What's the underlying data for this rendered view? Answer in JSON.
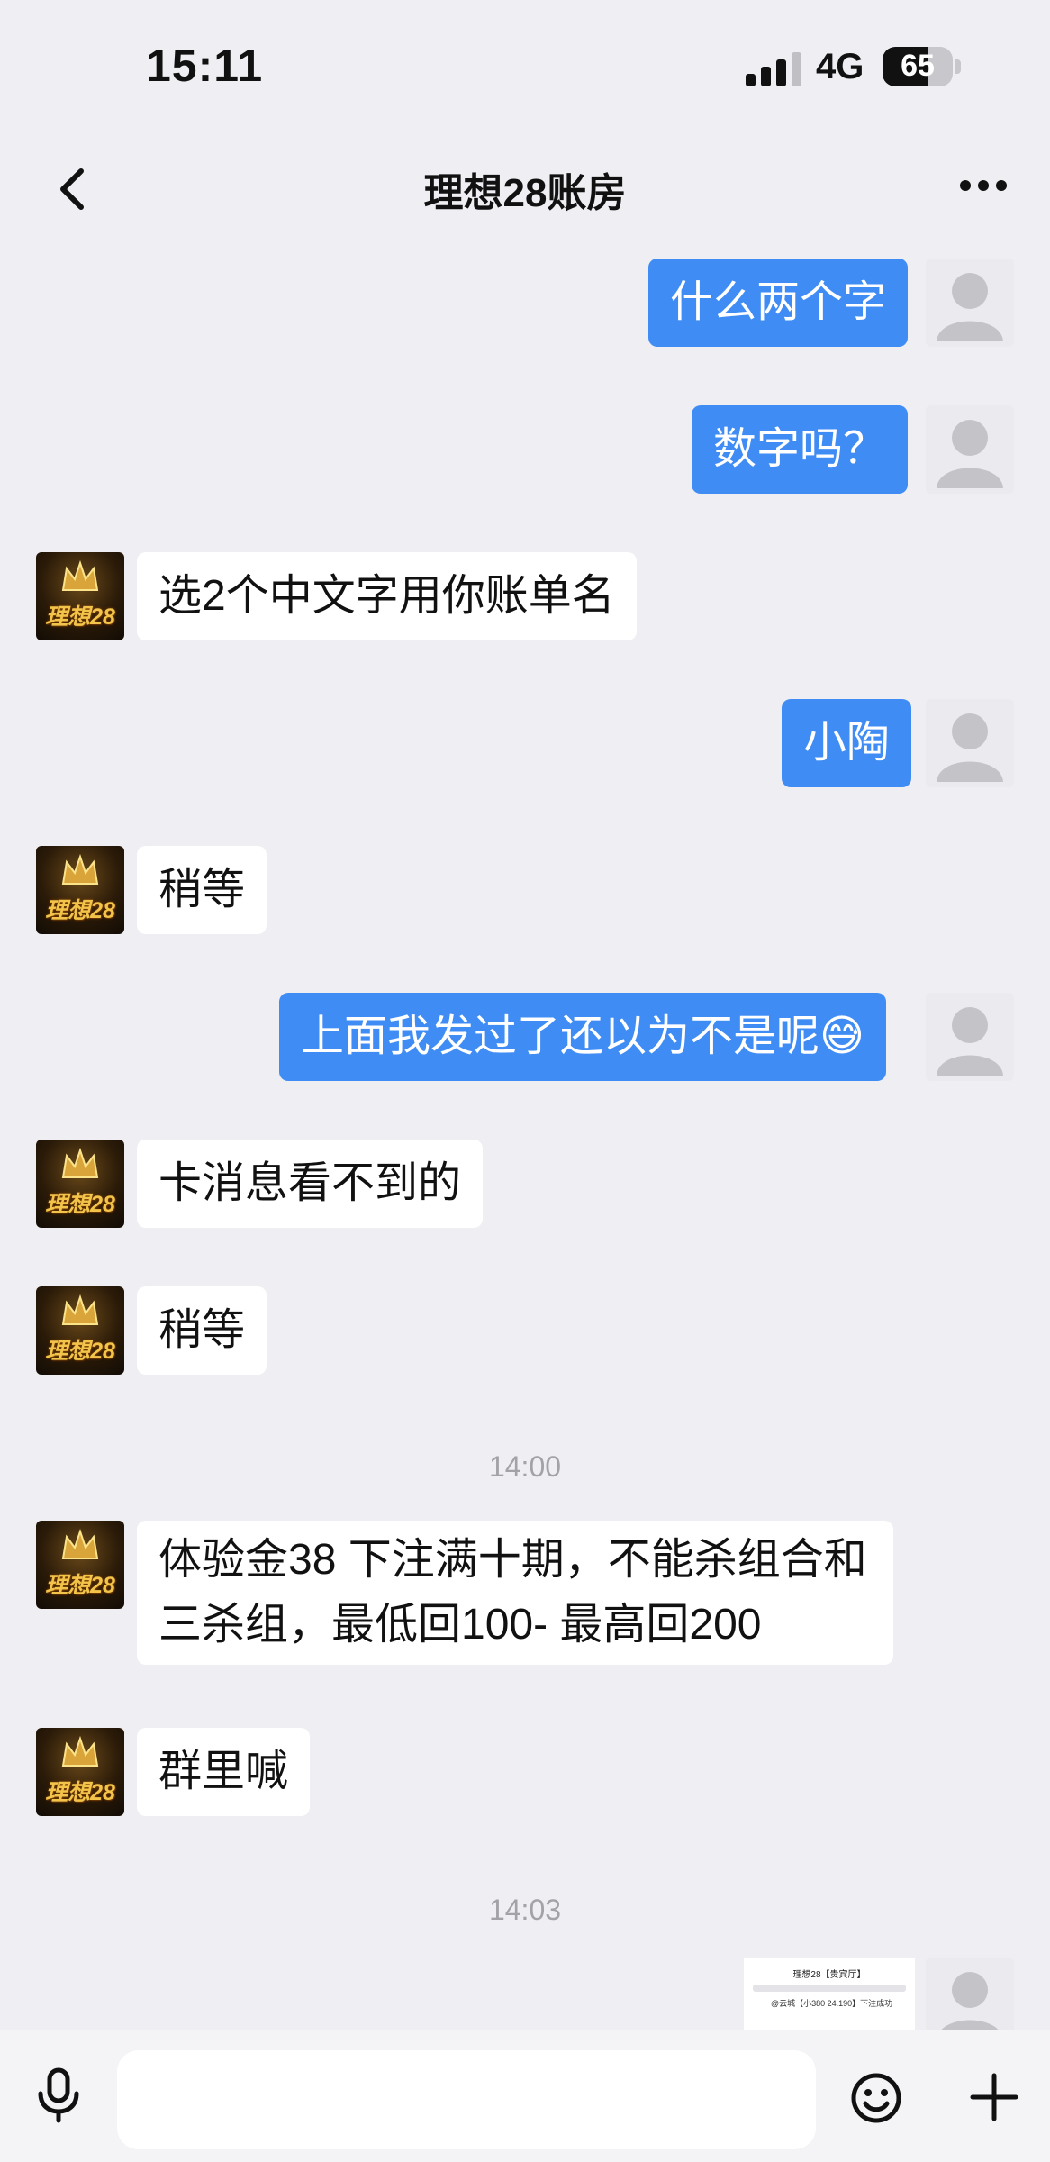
{
  "status": {
    "time": "15:11",
    "network": "4G",
    "battery": "65",
    "battery_level": 0.65
  },
  "nav": {
    "title": "理想28账房",
    "back_icon": "chevron-left-icon",
    "more_icon": "more-dots-icon"
  },
  "bot": {
    "avatar_text": "理想28"
  },
  "messages": [
    {
      "from": "me",
      "text": "什么两个字"
    },
    {
      "from": "me",
      "text": "数字吗？"
    },
    {
      "from": "bot",
      "text": "选2个中文字用你账单名"
    },
    {
      "from": "me",
      "text": "小陶"
    },
    {
      "from": "bot",
      "text": "稍等"
    },
    {
      "from": "me",
      "text": "上面我发过了还以为不是呢😅"
    },
    {
      "from": "bot",
      "text": "卡消息看不到的"
    },
    {
      "from": "bot",
      "text": "稍等"
    },
    {
      "type": "time",
      "text": "14:00"
    },
    {
      "from": "bot",
      "text": "体验金38  下注满十期，不能杀组合和三杀组，最低回100- 最高回200"
    },
    {
      "from": "bot",
      "text": "群里喊"
    },
    {
      "type": "time",
      "text": "14:03"
    },
    {
      "from": "me",
      "type": "image",
      "thumb_title": "理想28【贵宾厅】",
      "thumb_text": "@云城【小380 24.190】下注成功"
    }
  ],
  "input": {
    "placeholder": "",
    "value": ""
  },
  "icons": {
    "mic": "microphone-icon",
    "emoji": "emoji-icon",
    "plus": "plus-icon"
  },
  "colors": {
    "out_bubble": "#3f8cf5",
    "in_bubble": "#ffffff",
    "background": "#efeff3"
  }
}
